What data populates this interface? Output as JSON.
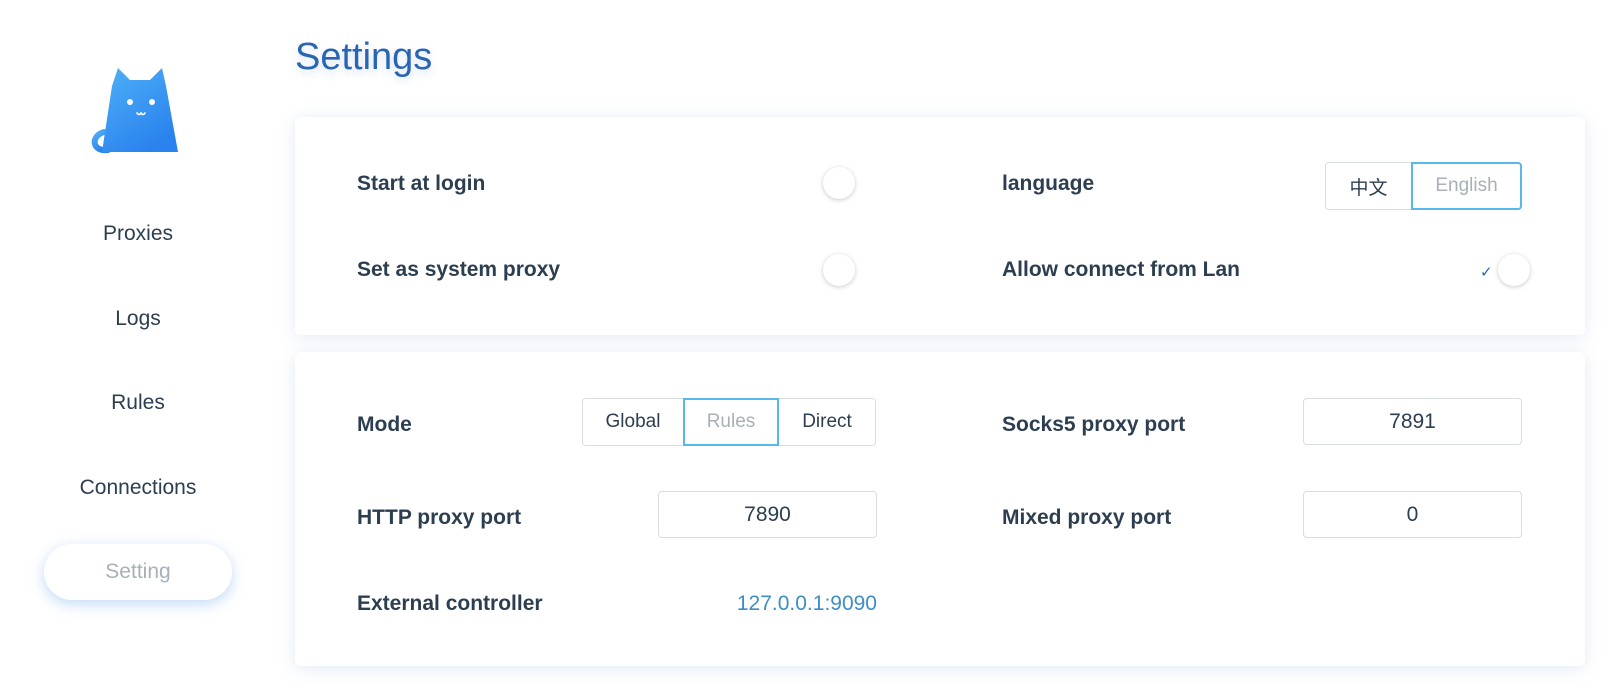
{
  "sidebar": {
    "logo_icon": "cat-logo-icon",
    "items": [
      {
        "label": "Proxies",
        "active": false
      },
      {
        "label": "Logs",
        "active": false
      },
      {
        "label": "Rules",
        "active": false
      },
      {
        "label": "Connections",
        "active": false
      },
      {
        "label": "Setting",
        "active": true
      }
    ]
  },
  "header": {
    "title": "Settings"
  },
  "general": {
    "start_at_login": {
      "label": "Start at login",
      "enabled": false
    },
    "system_proxy": {
      "label": "Set as system proxy",
      "enabled": false
    },
    "language": {
      "label": "language",
      "options": [
        "中文",
        "English"
      ],
      "selected": "English"
    },
    "allow_lan": {
      "label": "Allow connect from Lan",
      "enabled": false,
      "check_glyph": "✓"
    }
  },
  "proxy": {
    "mode": {
      "label": "Mode",
      "options": [
        "Global",
        "Rules",
        "Direct"
      ],
      "selected": "Rules"
    },
    "socks5_port": {
      "label": "Socks5 proxy port",
      "value": "7891"
    },
    "http_port": {
      "label": "HTTP proxy port",
      "value": "7890"
    },
    "mixed_port": {
      "label": "Mixed proxy port",
      "value": "0"
    },
    "external_controller": {
      "label": "External controller",
      "value": "127.0.0.1:9090"
    }
  },
  "colors": {
    "accent": "#2865b4",
    "selected_border": "#5ab7ec",
    "link": "#3d8ec4",
    "logo_gradient_start": "#4fb0f7",
    "logo_gradient_end": "#2a82ee"
  }
}
